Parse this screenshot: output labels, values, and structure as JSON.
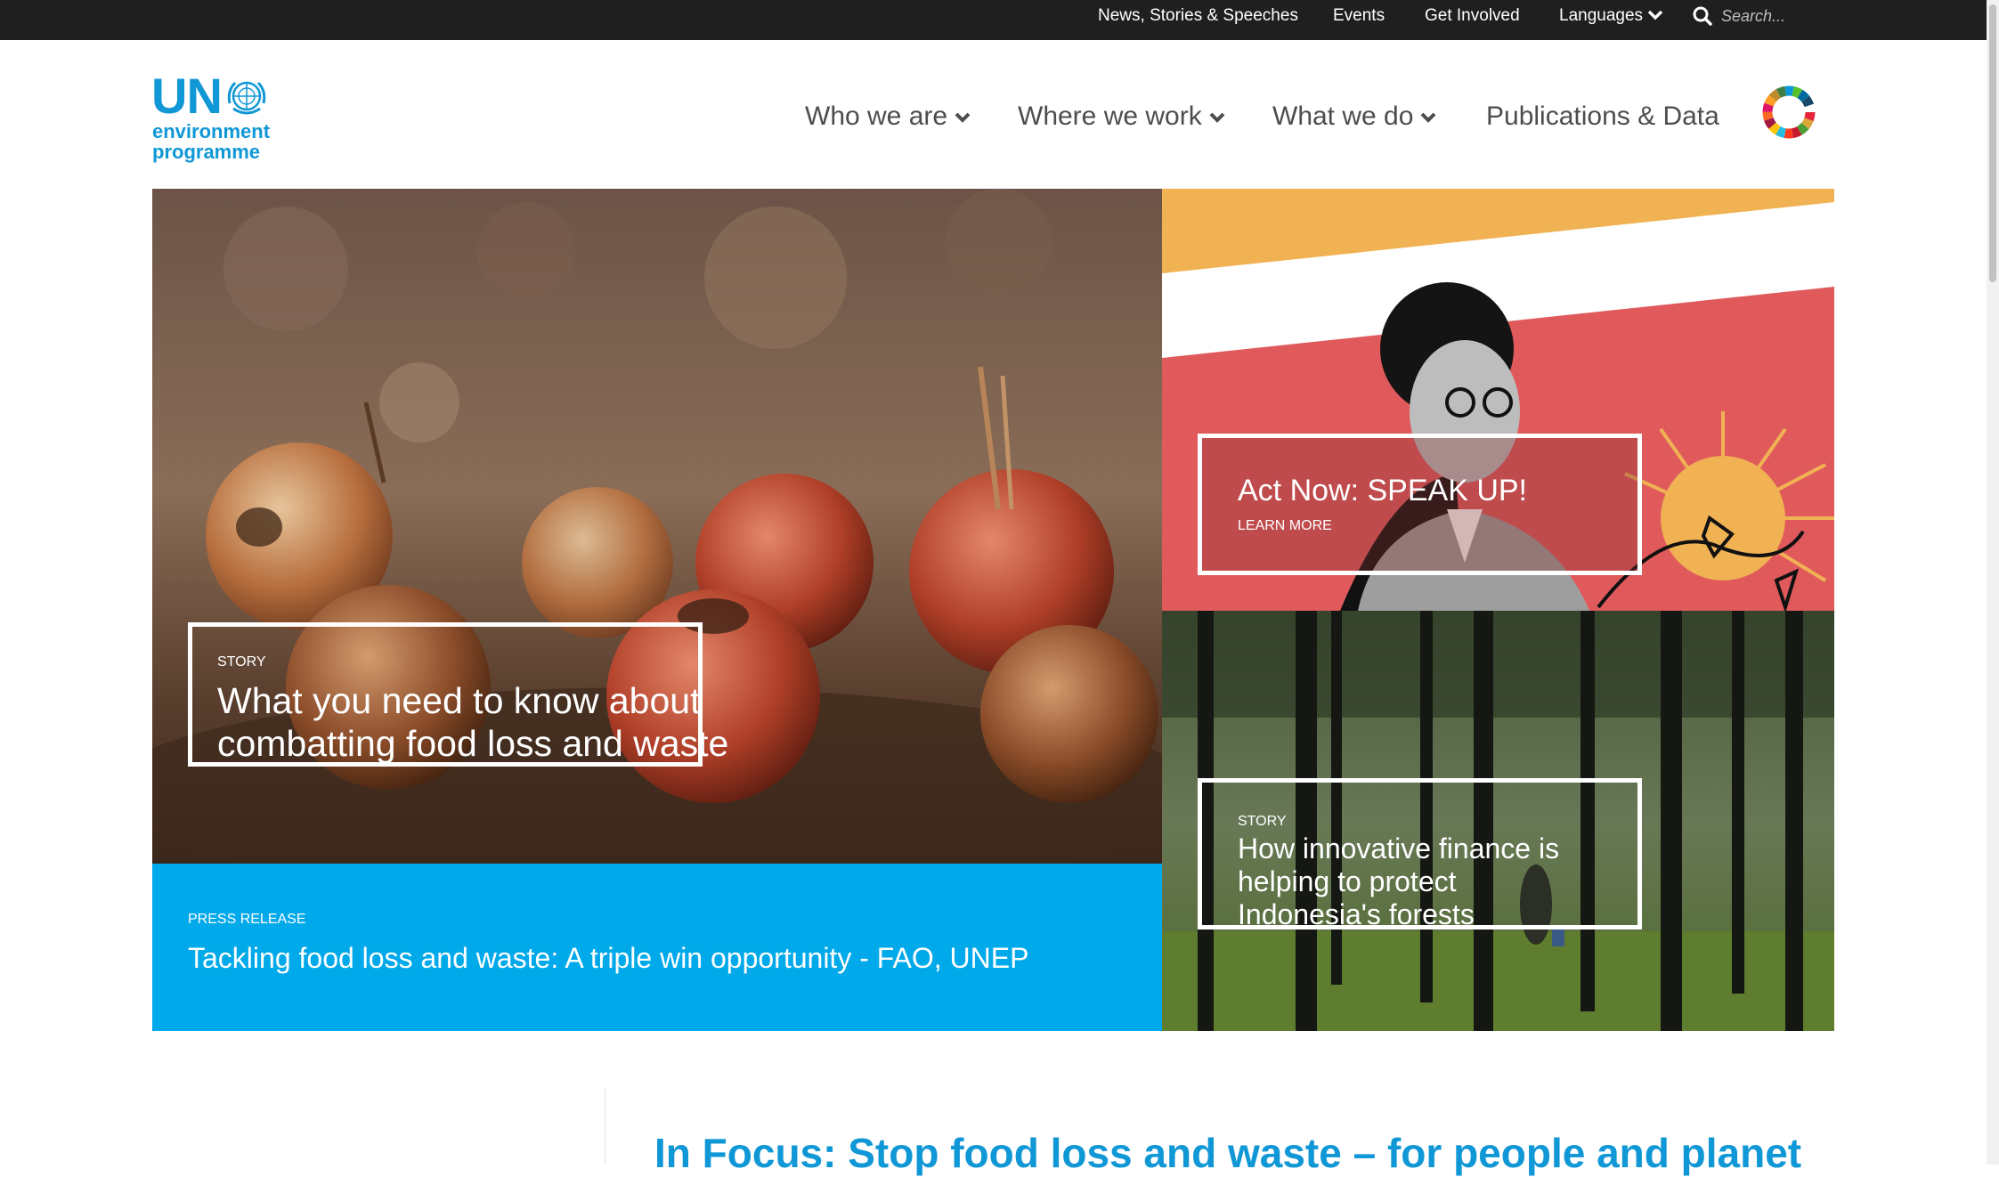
{
  "topbar": {
    "links": [
      "News, Stories & Speeches",
      "Events",
      "Get Involved",
      "Languages"
    ],
    "search_placeholder": "Search..."
  },
  "logo": {
    "line1": "UN",
    "line2": "environment",
    "line3": "programme"
  },
  "nav": {
    "items": [
      "Who we are",
      "Where we work",
      "What we do",
      "Publications & Data"
    ]
  },
  "hero": {
    "main_kicker": "STORY",
    "main_title_line1": "What you need to know about",
    "main_title_line2": "combatting food loss and waste",
    "press_kicker": "PRESS RELEASE",
    "press_title": "Tackling food loss and waste: A triple win opportunity - FAO, UNEP",
    "act_title": "Act Now: SPEAK UP!",
    "act_link": "LEARN MORE",
    "forest_kicker": "STORY",
    "forest_title_line1": "How innovative finance is",
    "forest_title_line2": "helping to protect",
    "forest_title_line3": "Indonesia's forests"
  },
  "in_focus": {
    "title": "In Focus: Stop food loss and waste – for people and planet"
  },
  "colors": {
    "brand_blue": "#0f97d6",
    "press_blue": "#00a9ea",
    "topbar_bg": "#1f1f1f",
    "act_coral": "#e05a5c",
    "act_yellow": "#f0b253"
  }
}
